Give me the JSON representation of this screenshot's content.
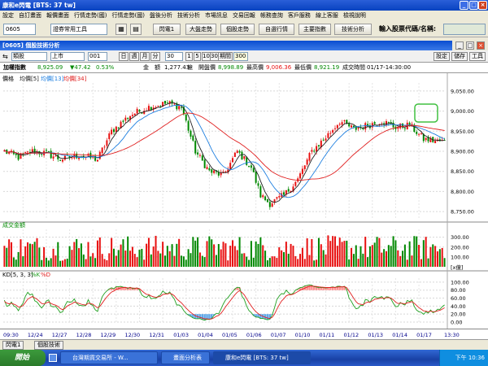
{
  "window": {
    "title": "康和e閃電 [BTS: 37 tw]"
  },
  "menu": [
    "設定",
    "自訂畫面",
    "報價畫面",
    "行情走勢(國)",
    "行情走勢(國)",
    "盤後分析",
    "技術分析",
    "市場訊息",
    "交易回報",
    "帳務查詢",
    "客戶服務",
    "線上客服",
    "檢視說明"
  ],
  "toolbar": {
    "code": "0605",
    "list": "證券常用工具",
    "buttons": [
      "閃電1",
      "大盤走勢",
      "個股走勢",
      "自選行情",
      "主要指數",
      "技術分析"
    ],
    "search_label": "輸入股票代碼/名稱:"
  },
  "panel": {
    "title": "[0605] 個股技術分析",
    "btns": [
      "設定",
      "儲存",
      "工具"
    ]
  },
  "controls": {
    "product": "類股",
    "market": "上市",
    "num": "001",
    "periods": [
      "日",
      "週",
      "月",
      "分"
    ],
    "period_value": "30",
    "ranges": [
      "1",
      "5",
      "10",
      "30"
    ],
    "count_label": "期間",
    "count_value": "300"
  },
  "info": {
    "name": "加權指數",
    "close": "8,925.09",
    "change": "▼47.42",
    "pct": "0.53%",
    "amt_label": "金　額",
    "amt": "1,277.43",
    "amt_unit": "億",
    "open_label": "開盤價",
    "open": "8,998.89",
    "high_label": "最高價",
    "high": "9,006.36",
    "low_label": "最低價",
    "low": "8,921.19",
    "time_label": "成交時間",
    "time": "01/17-14:30:00"
  },
  "legends": {
    "price": "價格",
    "ma5": "均價[5]",
    "ma13": "均價[13]",
    "ma34": "均價[34]",
    "vol": "成交金額",
    "kd": "KD[5, 3, 3]",
    "k": "%K",
    "d": "%D"
  },
  "colors": {
    "up": "#e81010",
    "down": "#008800",
    "ma5": "#202020",
    "ma13": "#1e7fe0",
    "ma34": "#e02020",
    "k": "#20a020",
    "d": "#e02020"
  },
  "chart_data": {
    "type": "candlestick",
    "price_axis": {
      "ticks": [
        9050,
        9000,
        8950,
        8900,
        8850,
        8800,
        8750
      ],
      "labels": [
        "9,050.00",
        "9,000.00",
        "8,950.00",
        "8,900.00",
        "8,850.00",
        "8,800.00",
        "8,750.00"
      ],
      "ylim": [
        8730,
        9070
      ]
    },
    "volume_axis": {
      "ticks": [
        300,
        200,
        100
      ],
      "labels": [
        "300.00",
        "200.00",
        "100.00"
      ],
      "unit": "[x億]",
      "ylim": [
        0,
        380
      ]
    },
    "kd_axis": {
      "ticks": [
        100,
        80,
        60,
        40,
        20,
        0
      ],
      "labels": [
        "100.00",
        "80.00",
        "60.00",
        "40.00",
        "20.00",
        "0.00"
      ],
      "ylim": [
        0,
        110
      ]
    },
    "x_labels": [
      "09:30",
      "12/24",
      "12/27",
      "12/28",
      "12/29",
      "12/30",
      "12/31",
      "01/03",
      "01/04",
      "01/05",
      "01/06",
      "01/07",
      "01/10",
      "01/11",
      "01/12",
      "01/13",
      "01/14",
      "01/17",
      "13:30"
    ],
    "anchors": [
      [
        0,
        8900
      ],
      [
        6,
        8885
      ],
      [
        12,
        8900
      ],
      [
        18,
        8895
      ],
      [
        24,
        8880
      ],
      [
        32,
        8890
      ],
      [
        40,
        8880
      ],
      [
        46,
        8950
      ],
      [
        54,
        8990
      ],
      [
        62,
        9010
      ],
      [
        70,
        9020
      ],
      [
        76,
        9010
      ],
      [
        82,
        8900
      ],
      [
        88,
        8850
      ],
      [
        94,
        8840
      ],
      [
        100,
        8900
      ],
      [
        106,
        8860
      ],
      [
        110,
        8790
      ],
      [
        114,
        8770
      ],
      [
        120,
        8790
      ],
      [
        126,
        8830
      ],
      [
        132,
        8900
      ],
      [
        138,
        8935
      ],
      [
        144,
        8975
      ],
      [
        150,
        8955
      ],
      [
        156,
        8965
      ],
      [
        162,
        8975
      ],
      [
        168,
        8960
      ],
      [
        174,
        8965
      ],
      [
        180,
        8930
      ],
      [
        186,
        8925
      ]
    ]
  }
}
